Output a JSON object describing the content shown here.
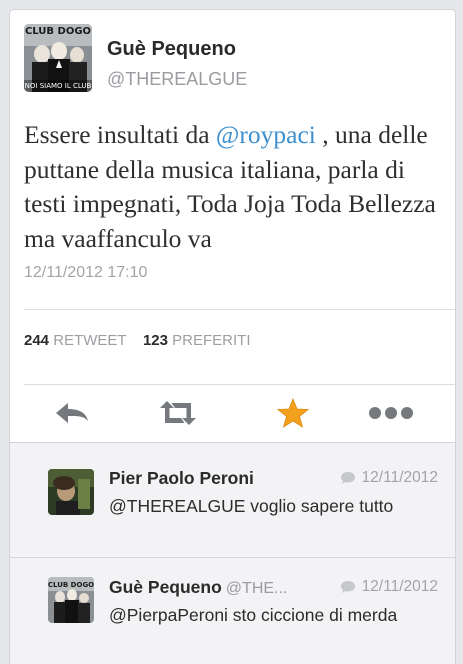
{
  "tweet": {
    "author_name": "Guè Pequeno",
    "author_handle": "@THEREALGUE",
    "avatar_text_top": "CLUB DOGO",
    "avatar_text_bottom": "NOI SIAMO IL CLUB",
    "text_before": "Essere insultati da ",
    "mention": "@roypaci",
    "text_after": " , una delle puttane della musica italiana, parla di testi impegnati, Toda Joja Toda Bellezza ma vaaffanculo va",
    "timestamp": "12/11/2012 17:10"
  },
  "stats": {
    "retweets_count": "244",
    "retweets_label": "RETWEET",
    "favorites_count": "123",
    "favorites_label": "PREFERITI"
  },
  "actions": [
    {
      "name": "reply",
      "icon": "reply-arrow-icon"
    },
    {
      "name": "retweet",
      "icon": "retweet-icon"
    },
    {
      "name": "favorite",
      "icon": "star-icon",
      "color": "#f3a01f"
    },
    {
      "name": "more",
      "icon": "more-dots-icon"
    }
  ],
  "replies": [
    {
      "author_name": "Pier Paolo Peroni",
      "author_handle": "",
      "timestamp": "12/11/2012",
      "text": "@THEREALGUE voglio sapere tutto"
    },
    {
      "author_name": "Guè Pequeno",
      "author_handle": "@THE...",
      "timestamp": "12/11/2012",
      "text": "@PierpaPeroni sto ciccione di merda"
    }
  ],
  "colors": {
    "link": "#3b8fcf",
    "star": "#f3a01f",
    "icon_gray": "#75787d"
  }
}
